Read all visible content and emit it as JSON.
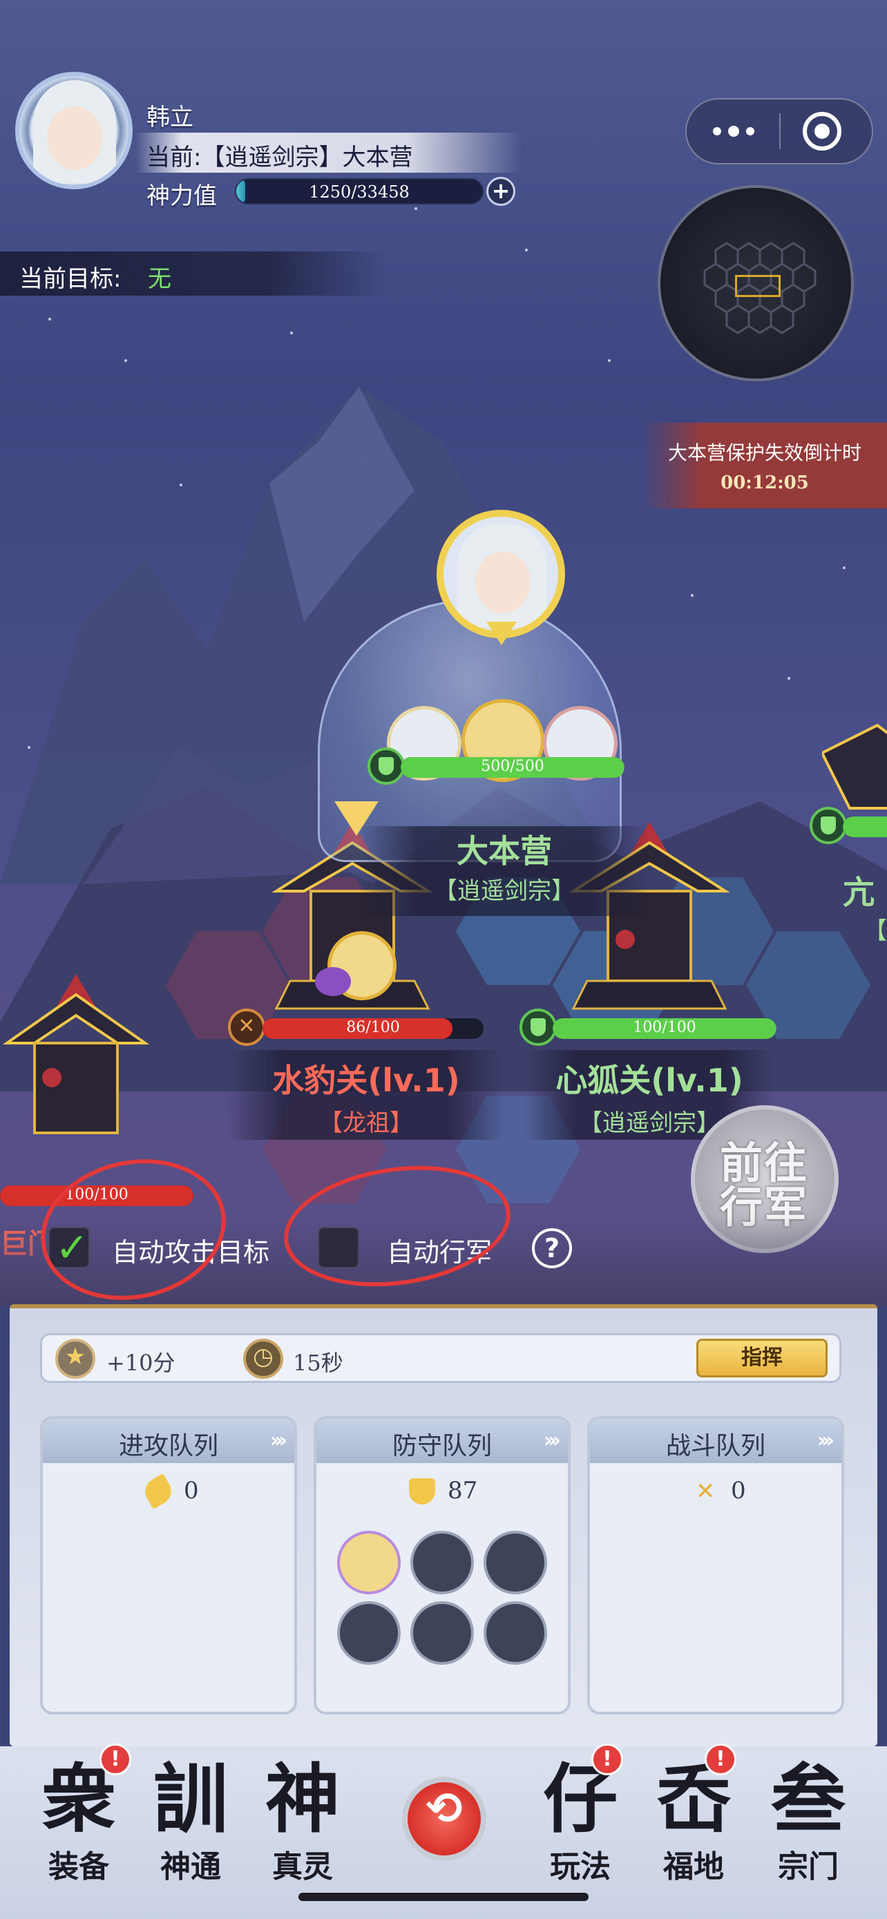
{
  "profile": {
    "name": "韩立",
    "location": "当前:【逍遥剑宗】大本营",
    "power_label": "神力值",
    "power_value": "1250/33458",
    "power_fraction": 0.037
  },
  "current_target": {
    "label": "当前目标:",
    "value": "无"
  },
  "capsule": {
    "more_icon": "more-dots-icon",
    "close_icon": "target-circle-icon"
  },
  "countdown": {
    "title": "大本营保护失效倒计时",
    "time": "00:12:05"
  },
  "map_nodes": {
    "base": {
      "hp": "500/500",
      "hp_fraction": 1.0,
      "name": "大本营",
      "sect": "【逍遥剑宗】"
    },
    "leopard_pass": {
      "hp": "86/100",
      "hp_fraction": 0.86,
      "name": "水豹关(lv.1)",
      "sect": "【龙祖】"
    },
    "fox_pass": {
      "hp": "100/100",
      "hp_fraction": 1.0,
      "name": "心狐关(lv.1)",
      "sect": "【逍遥剑宗】"
    },
    "partial_right": {
      "name": "亢",
      "sect": "【"
    },
    "partial_left": {
      "hp": "100/100",
      "hp_fraction": 1.0,
      "name": "巨门"
    }
  },
  "goto_button": "前往行军",
  "toggles": {
    "auto_attack": {
      "label": "自动攻击目标",
      "checked": true
    },
    "auto_march": {
      "label": "自动行军",
      "checked": false
    },
    "help": "?"
  },
  "info_bar": {
    "points": "+10分",
    "time": "15秒",
    "command": "指挥"
  },
  "queues": [
    {
      "title": "进攻队列",
      "count": "0",
      "icon": "attack-icon"
    },
    {
      "title": "防守队列",
      "count": "87",
      "icon": "shield-icon"
    },
    {
      "title": "战斗队列",
      "count": "0",
      "icon": "crossed-swords-icon"
    }
  ],
  "queue_arrows": "›››",
  "nav": {
    "items": [
      {
        "label": "装备",
        "glyph": "衆",
        "badge": "!"
      },
      {
        "label": "神通",
        "glyph": "訓",
        "badge": ""
      },
      {
        "label": "真灵",
        "glyph": "神",
        "badge": ""
      },
      {
        "label": "玩法",
        "glyph": "仔",
        "badge": "!"
      },
      {
        "label": "福地",
        "glyph": "岙",
        "badge": "!"
      },
      {
        "label": "宗门",
        "glyph": "叁",
        "badge": ""
      }
    ],
    "center": "⟲"
  },
  "colors": {
    "accent_gold": "#f0d050",
    "hp_green": "#5ccf4a",
    "hp_red": "#d8302a",
    "checkmark": "#5ed241",
    "annotation": "#e43838"
  }
}
